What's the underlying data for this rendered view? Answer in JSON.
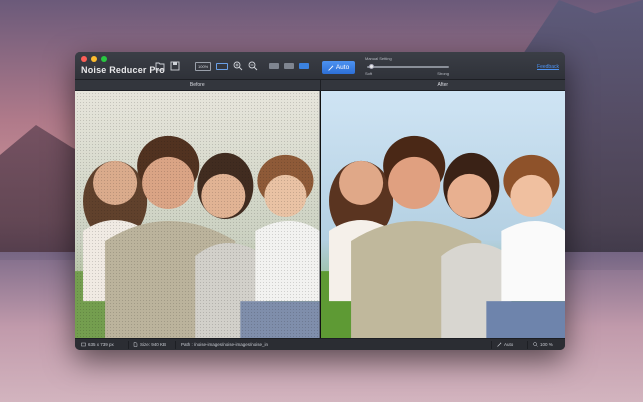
{
  "app": {
    "title": "Noise Reducer Pro"
  },
  "toolbar": {
    "zoom_label": "100%",
    "auto_label": "Auto",
    "manual_label": "Manual Setting",
    "slider_min": "Soft",
    "slider_max": "Strong",
    "slider_value": 0.02,
    "feedback_label": "Feedback"
  },
  "panels": {
    "before_label": "Before",
    "after_label": "After"
  },
  "status": {
    "dimensions": "635 x 739 px",
    "size": "Size: 940 KB",
    "path": "Path : /noise-images/noise-images/noise_in",
    "mode": "Auto",
    "zoom": "100 %"
  },
  "colors": {
    "accent": "#3b82e0",
    "feedback_link": "#4d92f0"
  }
}
